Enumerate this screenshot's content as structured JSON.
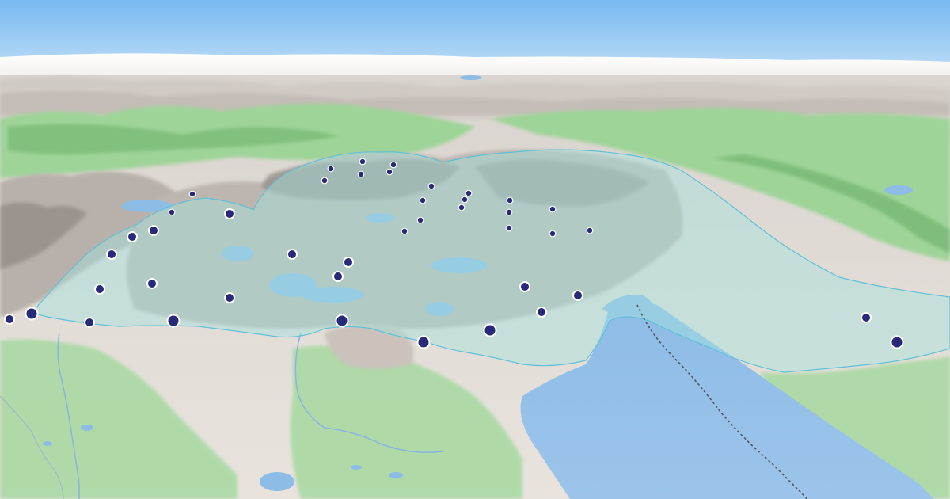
{
  "map": {
    "view": "3d-terrain",
    "colors": {
      "sky_top": "#7dbdf2",
      "sky_bottom": "#cfe6fa",
      "haze": "#f4f1ee",
      "land_far": "#e8e3de",
      "forest": "#a8dba2",
      "forest_dark": "#7fc27a",
      "rock": "#bdb6b0",
      "rock_shadow": "#8e8882",
      "water": "#8fbde6",
      "water_dark": "#7aaee0",
      "stream": "#8ab4e0",
      "region_fill": "#a5e3de",
      "region_stroke": "#5fc1d8",
      "marker_fill": "#262a78",
      "marker_stroke": "#ffffff",
      "boundary_line": "#555555"
    },
    "markers": [
      {
        "id": "m01",
        "size": "small"
      },
      {
        "id": "m02",
        "size": "small"
      },
      {
        "id": "m03",
        "size": "small"
      },
      {
        "id": "m04",
        "size": "small"
      },
      {
        "id": "m05",
        "size": "small"
      },
      {
        "id": "m06",
        "size": "small"
      },
      {
        "id": "m07",
        "size": "small"
      },
      {
        "id": "m08",
        "size": "small"
      },
      {
        "id": "m09",
        "size": "small"
      },
      {
        "id": "m10",
        "size": "small"
      },
      {
        "id": "m11",
        "size": "small"
      },
      {
        "id": "m12",
        "size": "small"
      },
      {
        "id": "m13",
        "size": "small"
      },
      {
        "id": "m14",
        "size": "small"
      },
      {
        "id": "m15",
        "size": "small"
      },
      {
        "id": "m16",
        "size": "small"
      },
      {
        "id": "m17",
        "size": "small"
      },
      {
        "id": "m18",
        "size": "small"
      },
      {
        "id": "m19",
        "size": "small"
      },
      {
        "id": "m20",
        "size": "small"
      },
      {
        "id": "m21",
        "size": "small"
      },
      {
        "id": "m22",
        "size": "medium"
      },
      {
        "id": "m23",
        "size": "medium"
      },
      {
        "id": "m24",
        "size": "medium"
      },
      {
        "id": "m25",
        "size": "medium"
      },
      {
        "id": "m26",
        "size": "medium"
      },
      {
        "id": "m27",
        "size": "medium"
      },
      {
        "id": "m28",
        "size": "medium"
      },
      {
        "id": "m29",
        "size": "medium"
      },
      {
        "id": "m30",
        "size": "medium"
      },
      {
        "id": "m31",
        "size": "medium"
      },
      {
        "id": "m32",
        "size": "medium"
      },
      {
        "id": "m33",
        "size": "medium"
      },
      {
        "id": "m34",
        "size": "medium"
      },
      {
        "id": "m35",
        "size": "medium"
      },
      {
        "id": "m36",
        "size": "medium"
      },
      {
        "id": "m37",
        "size": "large"
      },
      {
        "id": "m38",
        "size": "large"
      },
      {
        "id": "m39",
        "size": "large"
      },
      {
        "id": "m40",
        "size": "large"
      },
      {
        "id": "m41",
        "size": "large"
      },
      {
        "id": "m42",
        "size": "large"
      },
      {
        "id": "m43",
        "size": "medium"
      },
      {
        "id": "m44",
        "size": "large"
      }
    ]
  }
}
